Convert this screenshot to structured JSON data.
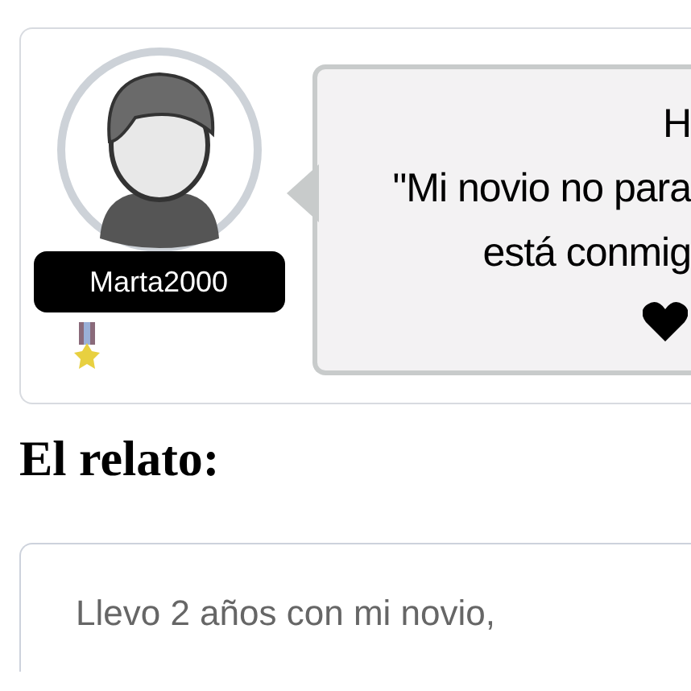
{
  "post": {
    "username": "Marta2000",
    "quote_lines": [
      "H",
      "\"Mi novio no para",
      "está conmig"
    ]
  },
  "section_title": "El relato:",
  "story": {
    "text": "Llevo 2 años con mi novio,"
  }
}
